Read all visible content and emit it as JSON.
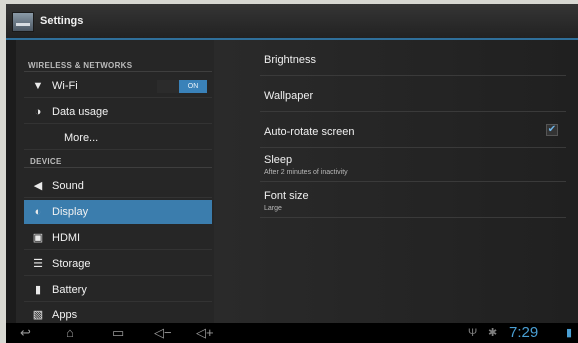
{
  "action_bar": {
    "title": "Settings",
    "icon": "settings-app-icon"
  },
  "left": {
    "section_wireless": "WIRELESS & NETWORKS",
    "wifi": {
      "label": "Wi-Fi",
      "toggle": "ON",
      "icon": "wifi-icon"
    },
    "data_usage": {
      "label": "Data usage",
      "icon": "data-usage-icon"
    },
    "more": {
      "label": "More..."
    },
    "section_device": "DEVICE",
    "sound": {
      "label": "Sound",
      "icon": "speaker-icon"
    },
    "display": {
      "label": "Display",
      "icon": "display-icon"
    },
    "hdmi": {
      "label": "HDMI",
      "icon": "hdmi-icon"
    },
    "storage": {
      "label": "Storage",
      "icon": "storage-icon"
    },
    "battery": {
      "label": "Battery",
      "icon": "battery-icon"
    },
    "apps": {
      "label": "Apps",
      "icon": "apps-icon"
    }
  },
  "right": {
    "brightness": "Brightness",
    "wallpaper": "Wallpaper",
    "auto_rotate": {
      "label": "Auto-rotate screen",
      "checked": true
    },
    "sleep": {
      "label": "Sleep",
      "summary": "After 2 minutes of inactivity"
    },
    "font_size": {
      "label": "Font size",
      "summary": "Large"
    }
  },
  "nav": {
    "back": "back-icon",
    "home": "home-icon",
    "recents": "recents-icon",
    "vol_down": "volume-down-icon",
    "vol_up": "volume-up-icon",
    "usb": "usb-icon",
    "debug": "debug-icon",
    "battery": "battery-status-icon",
    "clock": "7:29"
  },
  "colors": {
    "accent": "#3b7dad",
    "clock": "#4a9fd4"
  }
}
